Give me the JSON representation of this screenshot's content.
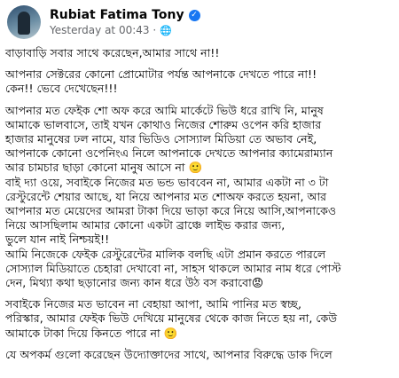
{
  "author": {
    "name": "Rubiat Fatima Tony",
    "timestamp": "Yesterday at 00:43",
    "verified_icon": "verified-badge-icon",
    "privacy_icon": "globe-icon"
  },
  "post": {
    "lines": [
      "বাড়াবাড়ি সবার সাথে করেছেন,আমার সাথে না!!",
      " আপনার সেক্টরের কোনো প্রোমোটার পর্যন্ত আপনাকে দেখতে পারে না!!",
      "কেন!!  ভেবে দেখেছেন!!!",
      "আপনার মত ফেইক শো অফ করে আমি মার্কেটে ভিউ ধরে রাখি নি, মানুষ",
      "আমাকে ভালবাসে,  তাই যখন কোথাও নিজের শোরুম ওপেন করি হাজার",
      "হাজার মানুষের ঢল নামে,  যার ভিডিও সোস্যাল মিডিয়া তে অভাব নেই,",
      "আপনাকে কোনো ওপেনিংএ নিলে আপনাকে  দেখতে আপনার ক্যামেরাম্যান",
      "আর চামচার ছাড়া কোনো মানুষ আসে না 🙂",
      "বাই দ্যা ওয়ে,  সবাইকে নিজের মত ভন্ড ভাববেন না,  আমার একটা না ৩ টা",
      "রেস্টুরেন্টে শেয়ার আছে, যা নিয়ে   আপনার মত শোঅফ করতে হয়না,  আর",
      "আপনার মত মেয়েদের আমরা টাকা দিয়ে ভাড়া করে নিয়ে আসি,আপনাকেও",
      "নিয়ে আসছিলাম আমার কোনো একটা ব্রাঞ্চে লাইভ করার জন্য,",
      " ভুলে যান নাই নিশ্চয়ই!!",
      "আমি নিজেকে ফেইক রেস্টুরেন্টের মালিক বলছি এটা প্রমান করতে পারলে",
      "সোস্যাল মিডিয়াতে চেহারা দেখাবো না,  সাহস থাকলে আমার নাম ধরে পোস্ট",
      "দেন,  মিথ্যা কথা ছড়ানোর জন্য কান ধরে উঠ বস করাবো😡",
      "সবাইকে নিজের মত ভাবেন না বেহায়া আপা,  আমি পানির মত স্বচ্ছ,",
      "পরিস্কার, আমার ফেইক ভিউ দেখিয়ে মানুষের থেকে কাজ নিতে হয় না, কেউ",
      "আমাকে টাকা দিয়ে কিনতে পারে না 🙂",
      "যে অপকর্ম গুলো করেছেন উদ্যোক্তাদের সাথে, আপনার বিরুদ্ধে ডাক দিলে"
    ]
  }
}
